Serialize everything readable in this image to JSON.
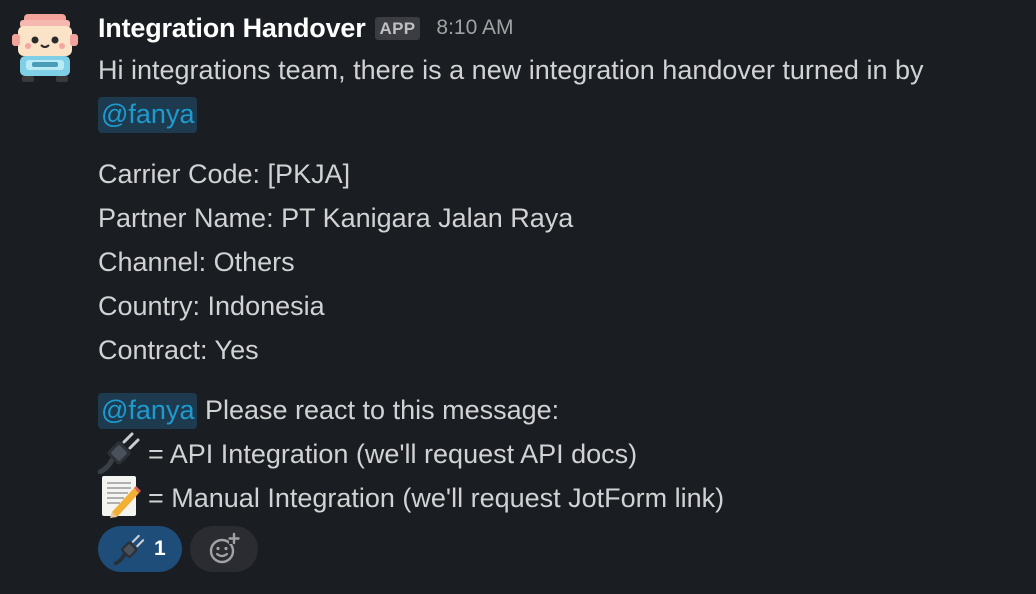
{
  "message": {
    "sender": "Integration Handover",
    "badge": "APP",
    "timestamp": "8:10 AM",
    "intro_text": "Hi integrations team, there is a new integration handover turned in by",
    "mention_user": "@fanya",
    "details": [
      "Carrier Code: [PKJA]",
      "Partner Name: PT Kanigara Jalan Raya",
      "Channel: Others",
      "Country: Indonesia",
      "Contract: Yes"
    ],
    "react_prompt": " Please react to this message:",
    "options": [
      {
        "icon": "electric-plug-icon",
        "text": "= API Integration (we'll request API docs)"
      },
      {
        "icon": "memo-icon",
        "text": "= Manual Integration (we'll request JotForm link)"
      }
    ]
  },
  "reactions": [
    {
      "icon": "electric-plug-icon",
      "count": "1"
    }
  ],
  "colors": {
    "background": "#1a1d21",
    "mention_text": "#1d9bd1",
    "mention_bg": "#1d3a4f",
    "reaction_active_bg": "#1e4d7a"
  }
}
